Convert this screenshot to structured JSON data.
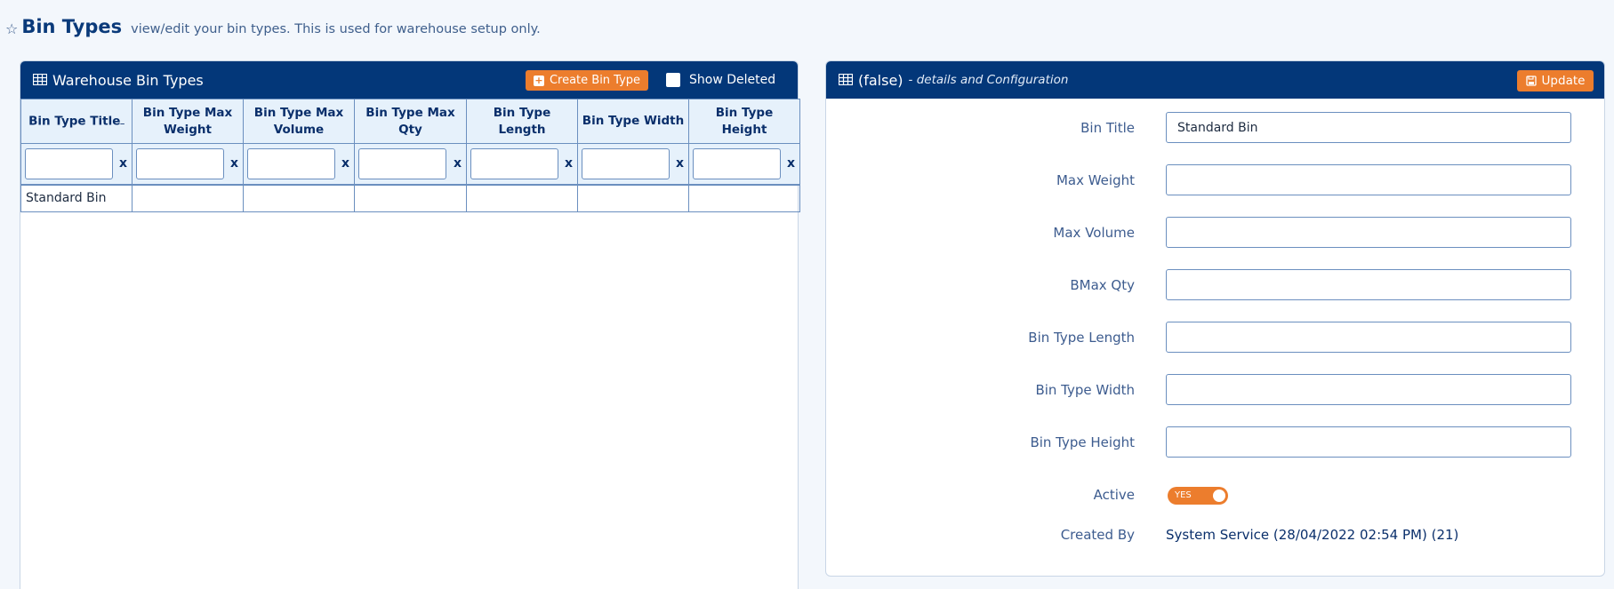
{
  "page": {
    "title": "Bin Types",
    "subtitle": "view/edit your bin types. This is used for warehouse setup only.",
    "icon": "star-icon"
  },
  "left_panel": {
    "title": "Warehouse Bin Types",
    "create_button": "Create Bin Type",
    "show_deleted_label": "Show Deleted",
    "columns": [
      "Bin Type Title",
      "Bin Type Max Weight",
      "Bin Type Max Volume",
      "Bin Type Max Qty",
      "Bin Type Length",
      "Bin Type Width",
      "Bin Type Height"
    ],
    "filter_clear": "x",
    "rows": [
      [
        "Standard Bin",
        "",
        "",
        "",
        "",
        "",
        ""
      ]
    ]
  },
  "right_panel": {
    "title": "(false)",
    "subtitle": "- details and Configuration",
    "update_button": "Update",
    "fields": [
      {
        "label": "Bin Title",
        "value": "Standard Bin"
      },
      {
        "label": "Max Weight",
        "value": ""
      },
      {
        "label": "Max Volume",
        "value": ""
      },
      {
        "label": "BMax Qty",
        "value": ""
      },
      {
        "label": "Bin Type Length",
        "value": ""
      },
      {
        "label": "Bin Type Width",
        "value": ""
      },
      {
        "label": "Bin Type Height",
        "value": ""
      }
    ],
    "active_label": "Active",
    "active_toggle": "YES",
    "created_by_label": "Created By",
    "created_by_value": "System Service (28/04/2022 02:54 PM) (21)"
  },
  "colors": {
    "header_bg": "#033779",
    "accent": "#ec7d2d",
    "table_header_bg": "#e6f1fb"
  }
}
